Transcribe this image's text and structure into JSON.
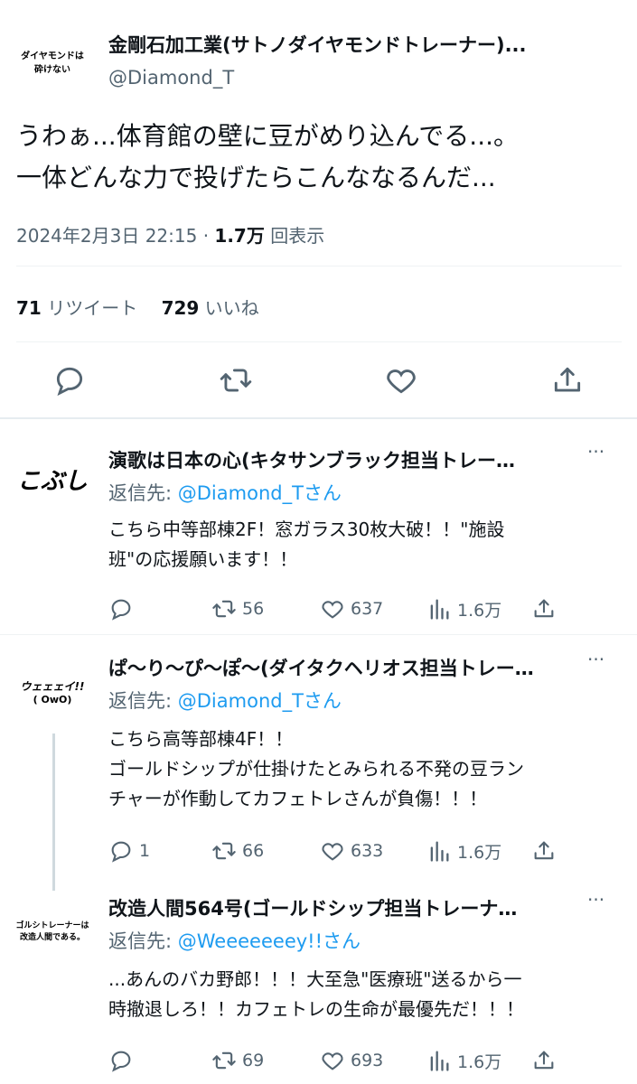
{
  "main_tweet": {
    "avatar_text_line1": "ダイヤモンドは",
    "avatar_text_line2": "砕けない",
    "display_name": "金剛石加工業(サトノダイヤモンドトレーナー)...",
    "handle": "@Diamond_T",
    "text_line1": "うわぁ...体育館の壁に豆がめり込んでる...。",
    "text_line2": "一体どんな力で投げたらこんななるんだ...",
    "timestamp": "2024年2月3日 22:15",
    "separator": "·",
    "views_count": "1.7万",
    "views_label": "回表示",
    "retweets_count": "71",
    "retweets_label": "リツイート",
    "likes_count": "729",
    "likes_label": "いいね"
  },
  "replies": [
    {
      "avatar_text_line1": "こぶし",
      "avatar_text_line2": "",
      "display_name": "演歌は日本の心(キタサンブラック担当トレー…",
      "reply_prefix": "返信先: ",
      "reply_mention": "@Diamond_Tさん",
      "text_lines": [
        "こちら中等部棟2F！窓ガラス30枚大破！！\"施設",
        "班\"の応援願います！！"
      ],
      "reply_count": "",
      "retweet_count": "56",
      "like_count": "637",
      "view_count": "1.6万"
    },
    {
      "avatar_text_line1": "ウェェェイ!!",
      "avatar_text_line2": "( OwO)",
      "display_name": "ぱ〜り〜ぴ〜ぽ〜(ダイタクヘリオス担当トレー…",
      "reply_prefix": "返信先: ",
      "reply_mention": "@Diamond_Tさん",
      "text_lines": [
        "こちら高等部棟4F！！",
        "ゴールドシップが仕掛けたとみられる不発の豆ラン",
        "チャーが作動してカフェトレさんが負傷！！！"
      ],
      "reply_count": "1",
      "retweet_count": "66",
      "like_count": "633",
      "view_count": "1.6万"
    },
    {
      "avatar_text_line1": "ゴルシトレーナーは",
      "avatar_text_line2": "改造人間である。",
      "display_name": "改造人間564号(ゴールドシップ担当トレーナ…",
      "reply_prefix": "返信先: ",
      "reply_mention": "@Weeeeeeey!!さん",
      "text_lines": [
        "...あんのバカ野郎！！！大至急\"医療班\"送るから一",
        "時撤退しろ！！カフェトレの生命が最優先だ！！！"
      ],
      "reply_count": "",
      "retweet_count": "69",
      "like_count": "693",
      "view_count": "1.6万"
    }
  ],
  "colors": {
    "text": "#0f1419",
    "secondary": "#536471",
    "link": "#1d9bf0",
    "divider": "#eff3f4"
  }
}
